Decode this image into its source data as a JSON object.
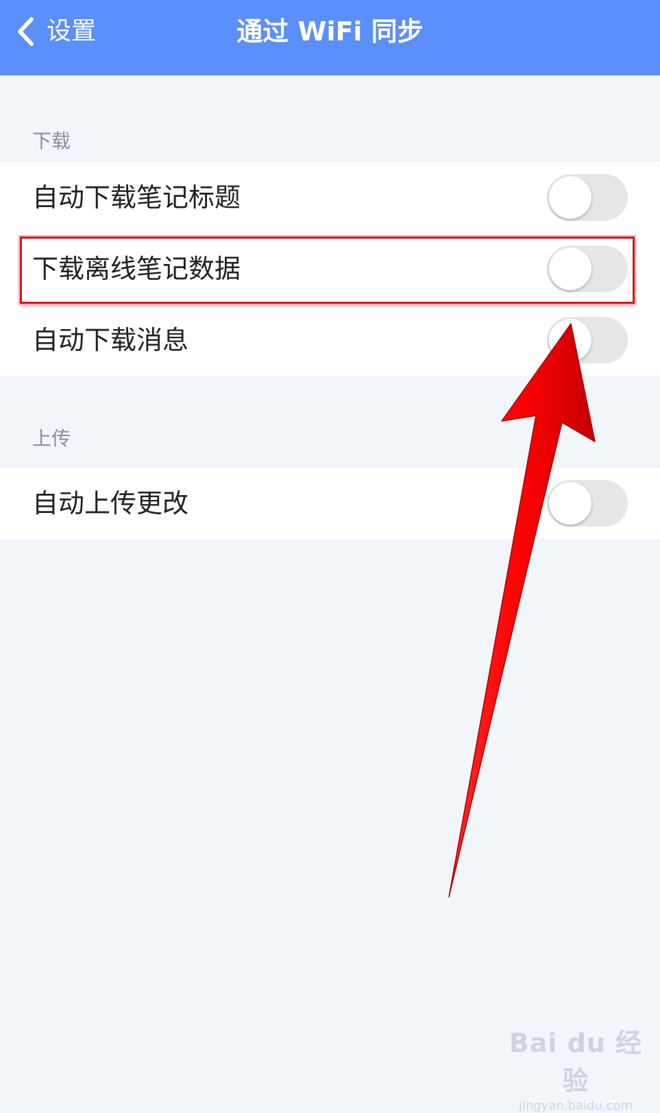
{
  "header": {
    "back_label": "设置",
    "title": "通过 WiFi 同步",
    "background_color": "#5b8ff9"
  },
  "sections": [
    {
      "label": "下载",
      "items": [
        {
          "label": "自动下载笔记标题",
          "enabled": false
        },
        {
          "label": "下载离线笔记数据",
          "enabled": false
        },
        {
          "label": "自动下载消息",
          "enabled": false
        }
      ]
    },
    {
      "label": "上传",
      "items": [
        {
          "label": "自动上传更改",
          "enabled": false
        }
      ]
    }
  ],
  "annotation": {
    "highlight_color": "#d9141e",
    "arrow_color": "#ff0000"
  },
  "watermark": {
    "main": "Bai du 经验",
    "sub": "jingyan.baidu.com"
  }
}
